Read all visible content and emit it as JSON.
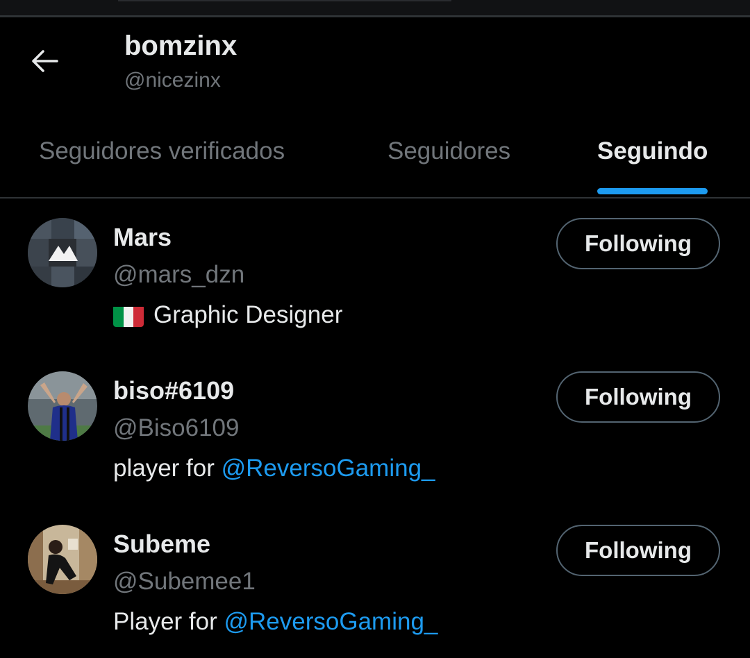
{
  "header": {
    "title": "bomzinx",
    "handle": "@nicezinx"
  },
  "tabs": [
    {
      "label": "Seguidores verificados",
      "active": false
    },
    {
      "label": "Seguidores",
      "active": false
    },
    {
      "label": "Seguindo",
      "active": true
    }
  ],
  "accent_color": "#1d9bf0",
  "users": [
    {
      "name": "Mars",
      "handle": "@mars_dzn",
      "bio_flag": "italy-flag-icon",
      "bio_text": "Graphic Designer",
      "bio_link": "",
      "button_label": "Following"
    },
    {
      "name": "biso#6109",
      "handle": "@Biso6109",
      "bio_text": "player for ",
      "bio_link": "@ReversoGaming_",
      "button_label": "Following"
    },
    {
      "name": "Subeme",
      "handle": "@Subemee1",
      "bio_text": "Player for ",
      "bio_link": "@ReversoGaming_",
      "button_label": "Following"
    }
  ]
}
